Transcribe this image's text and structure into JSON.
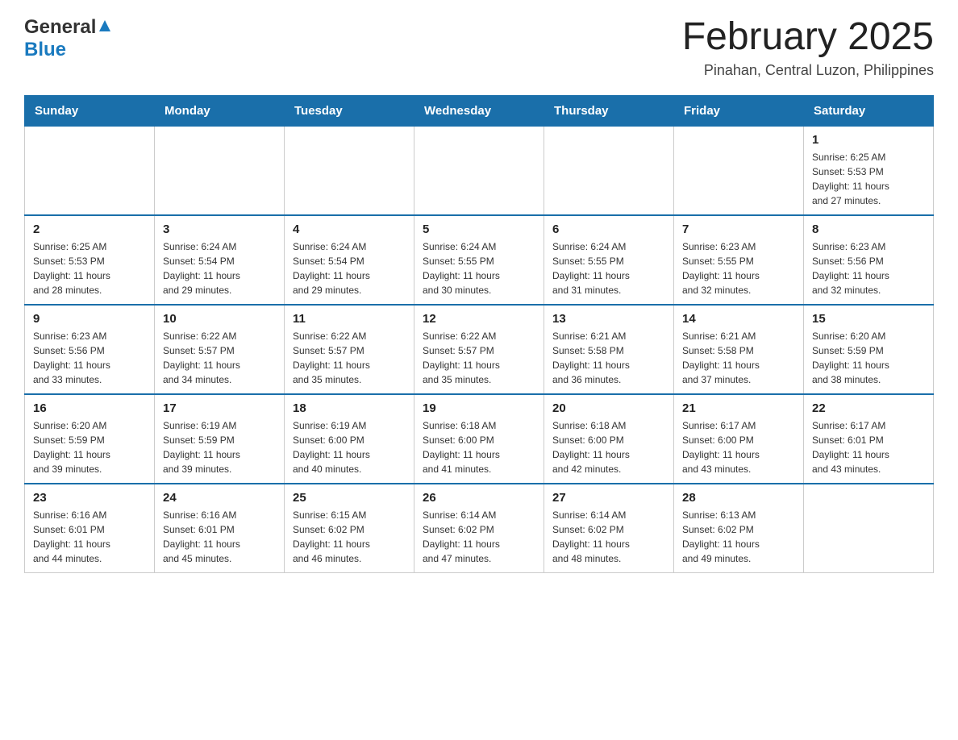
{
  "header": {
    "logo_general": "General",
    "logo_blue": "Blue",
    "month_title": "February 2025",
    "location": "Pinahan, Central Luzon, Philippines"
  },
  "weekdays": [
    "Sunday",
    "Monday",
    "Tuesday",
    "Wednesday",
    "Thursday",
    "Friday",
    "Saturday"
  ],
  "weeks": [
    {
      "days": [
        {
          "num": "",
          "info": ""
        },
        {
          "num": "",
          "info": ""
        },
        {
          "num": "",
          "info": ""
        },
        {
          "num": "",
          "info": ""
        },
        {
          "num": "",
          "info": ""
        },
        {
          "num": "",
          "info": ""
        },
        {
          "num": "1",
          "info": "Sunrise: 6:25 AM\nSunset: 5:53 PM\nDaylight: 11 hours\nand 27 minutes."
        }
      ]
    },
    {
      "days": [
        {
          "num": "2",
          "info": "Sunrise: 6:25 AM\nSunset: 5:53 PM\nDaylight: 11 hours\nand 28 minutes."
        },
        {
          "num": "3",
          "info": "Sunrise: 6:24 AM\nSunset: 5:54 PM\nDaylight: 11 hours\nand 29 minutes."
        },
        {
          "num": "4",
          "info": "Sunrise: 6:24 AM\nSunset: 5:54 PM\nDaylight: 11 hours\nand 29 minutes."
        },
        {
          "num": "5",
          "info": "Sunrise: 6:24 AM\nSunset: 5:55 PM\nDaylight: 11 hours\nand 30 minutes."
        },
        {
          "num": "6",
          "info": "Sunrise: 6:24 AM\nSunset: 5:55 PM\nDaylight: 11 hours\nand 31 minutes."
        },
        {
          "num": "7",
          "info": "Sunrise: 6:23 AM\nSunset: 5:55 PM\nDaylight: 11 hours\nand 32 minutes."
        },
        {
          "num": "8",
          "info": "Sunrise: 6:23 AM\nSunset: 5:56 PM\nDaylight: 11 hours\nand 32 minutes."
        }
      ]
    },
    {
      "days": [
        {
          "num": "9",
          "info": "Sunrise: 6:23 AM\nSunset: 5:56 PM\nDaylight: 11 hours\nand 33 minutes."
        },
        {
          "num": "10",
          "info": "Sunrise: 6:22 AM\nSunset: 5:57 PM\nDaylight: 11 hours\nand 34 minutes."
        },
        {
          "num": "11",
          "info": "Sunrise: 6:22 AM\nSunset: 5:57 PM\nDaylight: 11 hours\nand 35 minutes."
        },
        {
          "num": "12",
          "info": "Sunrise: 6:22 AM\nSunset: 5:57 PM\nDaylight: 11 hours\nand 35 minutes."
        },
        {
          "num": "13",
          "info": "Sunrise: 6:21 AM\nSunset: 5:58 PM\nDaylight: 11 hours\nand 36 minutes."
        },
        {
          "num": "14",
          "info": "Sunrise: 6:21 AM\nSunset: 5:58 PM\nDaylight: 11 hours\nand 37 minutes."
        },
        {
          "num": "15",
          "info": "Sunrise: 6:20 AM\nSunset: 5:59 PM\nDaylight: 11 hours\nand 38 minutes."
        }
      ]
    },
    {
      "days": [
        {
          "num": "16",
          "info": "Sunrise: 6:20 AM\nSunset: 5:59 PM\nDaylight: 11 hours\nand 39 minutes."
        },
        {
          "num": "17",
          "info": "Sunrise: 6:19 AM\nSunset: 5:59 PM\nDaylight: 11 hours\nand 39 minutes."
        },
        {
          "num": "18",
          "info": "Sunrise: 6:19 AM\nSunset: 6:00 PM\nDaylight: 11 hours\nand 40 minutes."
        },
        {
          "num": "19",
          "info": "Sunrise: 6:18 AM\nSunset: 6:00 PM\nDaylight: 11 hours\nand 41 minutes."
        },
        {
          "num": "20",
          "info": "Sunrise: 6:18 AM\nSunset: 6:00 PM\nDaylight: 11 hours\nand 42 minutes."
        },
        {
          "num": "21",
          "info": "Sunrise: 6:17 AM\nSunset: 6:00 PM\nDaylight: 11 hours\nand 43 minutes."
        },
        {
          "num": "22",
          "info": "Sunrise: 6:17 AM\nSunset: 6:01 PM\nDaylight: 11 hours\nand 43 minutes."
        }
      ]
    },
    {
      "days": [
        {
          "num": "23",
          "info": "Sunrise: 6:16 AM\nSunset: 6:01 PM\nDaylight: 11 hours\nand 44 minutes."
        },
        {
          "num": "24",
          "info": "Sunrise: 6:16 AM\nSunset: 6:01 PM\nDaylight: 11 hours\nand 45 minutes."
        },
        {
          "num": "25",
          "info": "Sunrise: 6:15 AM\nSunset: 6:02 PM\nDaylight: 11 hours\nand 46 minutes."
        },
        {
          "num": "26",
          "info": "Sunrise: 6:14 AM\nSunset: 6:02 PM\nDaylight: 11 hours\nand 47 minutes."
        },
        {
          "num": "27",
          "info": "Sunrise: 6:14 AM\nSunset: 6:02 PM\nDaylight: 11 hours\nand 48 minutes."
        },
        {
          "num": "28",
          "info": "Sunrise: 6:13 AM\nSunset: 6:02 PM\nDaylight: 11 hours\nand 49 minutes."
        },
        {
          "num": "",
          "info": ""
        }
      ]
    }
  ]
}
